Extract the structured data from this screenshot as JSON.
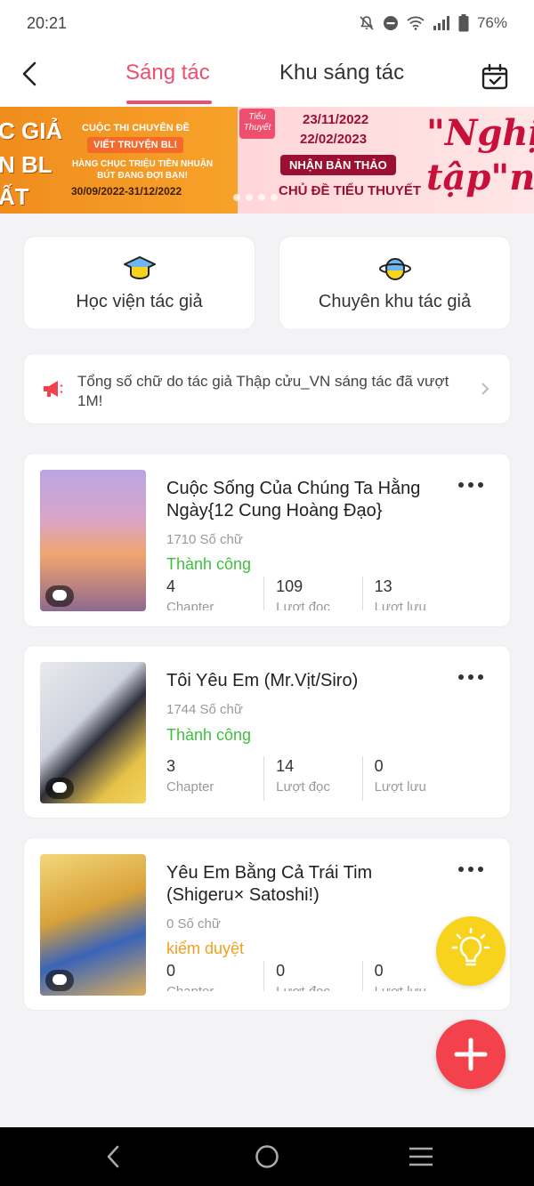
{
  "status_bar": {
    "time": "20:21",
    "battery": "76%",
    "icons": [
      "mute-icon",
      "dnd-icon",
      "wifi-icon",
      "signal-icon",
      "battery-icon"
    ]
  },
  "header": {
    "tab_active": "Sáng tác",
    "tab_inactive": "Khu sáng tác",
    "accent_color": "#ee4f6f"
  },
  "banner": {
    "left": {
      "big_line1": "C GIẢ",
      "big_line2": "N BL",
      "big_line3": "ẤT",
      "line1": "CUỘC THI CHUYÊN ĐỀ",
      "line2": "VIẾT TRUYỆN BL!",
      "line3": "HÀNG CHỤC TRIỆU TIỀN NHUẬN BÚT ĐANG ĐỢI BẠN!",
      "dates": "30/09/2022-31/12/2022"
    },
    "right": {
      "logo": "Tiểu Thuyết",
      "date1": "23/11/2022",
      "date2": "22/02/2023",
      "pill": "NHẬN BẢN THẢO",
      "subtitle": "CHỦ ĐỀ TIỂU THUYẾT",
      "big1": "\"Nghịc",
      "big2": "tập\"nữ"
    }
  },
  "quick_links": {
    "academy": "Học viện tác giả",
    "zone": "Chuyên khu tác giả"
  },
  "notice": {
    "text": "Tổng số chữ do tác giả Thập cửu_VN sáng tác đã vượt 1M!"
  },
  "works": [
    {
      "title": "Cuộc Sống Của Chúng Ta Hằng Ngày{12 Cung Hoàng Đạo}",
      "words": "1710 Số chữ",
      "status": "Thành công",
      "status_color": "#3fbf3f",
      "chapters": "4",
      "chapters_label": "Chapter",
      "reads": "109",
      "reads_label": "Lượt đọc",
      "saves": "13",
      "saves_label": "Lượt lưu"
    },
    {
      "title": "Tôi Yêu Em (Mr.Vịt/Siro)",
      "words": "1744 Số chữ",
      "status": "Thành công",
      "status_color": "#3fbf3f",
      "chapters": "3",
      "chapters_label": "Chapter",
      "reads": "14",
      "reads_label": "Lượt đọc",
      "saves": "0",
      "saves_label": "Lượt lưu"
    },
    {
      "title": "Yêu Em Bằng Cả Trái Tim (Shigeru× Satoshi!)",
      "words": "0 Số chữ",
      "status": "kiểm duyệt",
      "status_color": "#f0a020",
      "chapters": "0",
      "chapters_label": "Chapter",
      "reads": "0",
      "reads_label": "Lượt đọc",
      "saves": "0",
      "saves_label": "Lượt lưu"
    }
  ],
  "fab": {
    "idea_color": "#f7d31d",
    "add_color": "#f3424c"
  }
}
